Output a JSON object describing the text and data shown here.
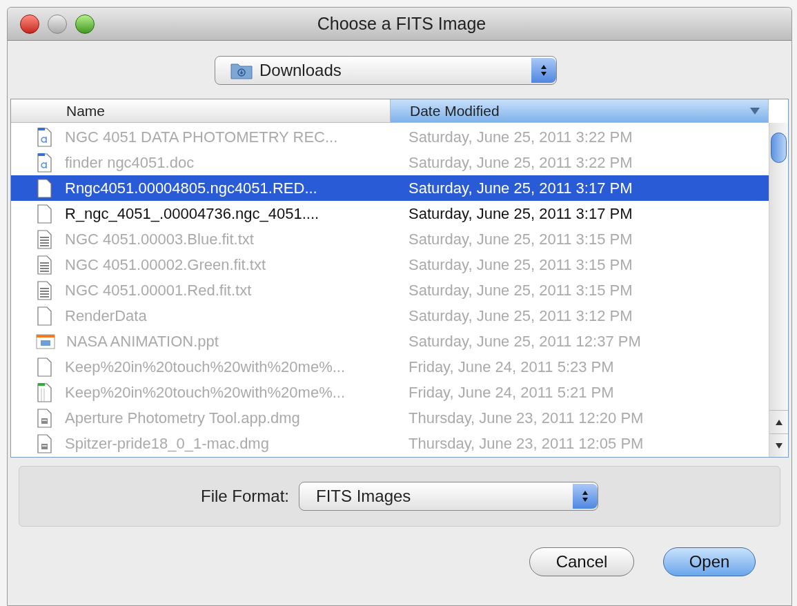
{
  "window": {
    "title": "Choose a FITS Image"
  },
  "location": {
    "value": "Downloads"
  },
  "columns": [
    {
      "label": "Name",
      "selected": false
    },
    {
      "label": "Date Modified",
      "selected": true
    }
  ],
  "files": [
    {
      "name": "NGC 4051 DATA PHOTOMETRY REC...",
      "date": "Saturday, June 25, 2011 3:22 PM",
      "kind": "doc",
      "disabled": true,
      "selected": false
    },
    {
      "name": "finder ngc4051.doc",
      "date": "Saturday, June 25, 2011 3:22 PM",
      "kind": "doc",
      "disabled": true,
      "selected": false
    },
    {
      "name": "Rngc4051.00004805.ngc4051.RED...",
      "date": "Saturday, June 25, 2011 3:17 PM",
      "kind": "blank",
      "disabled": false,
      "selected": true
    },
    {
      "name": "R_ngc_4051_.00004736.ngc_4051....",
      "date": "Saturday, June 25, 2011 3:17 PM",
      "kind": "blank",
      "disabled": false,
      "selected": false
    },
    {
      "name": "NGC 4051.00003.Blue.fit.txt",
      "date": "Saturday, June 25, 2011 3:15 PM",
      "kind": "text",
      "disabled": true,
      "selected": false
    },
    {
      "name": "NGC 4051.00002.Green.fit.txt",
      "date": "Saturday, June 25, 2011 3:15 PM",
      "kind": "text",
      "disabled": true,
      "selected": false
    },
    {
      "name": "NGC 4051.00001.Red.fit.txt",
      "date": "Saturday, June 25, 2011 3:15 PM",
      "kind": "text",
      "disabled": true,
      "selected": false
    },
    {
      "name": "RenderData",
      "date": "Saturday, June 25, 2011 3:12 PM",
      "kind": "blank",
      "disabled": true,
      "selected": false
    },
    {
      "name": "NASA ANIMATION.ppt",
      "date": "Saturday, June 25, 2011 12:37 PM",
      "kind": "slides",
      "disabled": true,
      "selected": false
    },
    {
      "name": "Keep%20in%20touch%20with%20me%...",
      "date": "Friday, June 24, 2011 5:23 PM",
      "kind": "blank",
      "disabled": true,
      "selected": false
    },
    {
      "name": "Keep%20in%20touch%20with%20me%...",
      "date": "Friday, June 24, 2011 5:21 PM",
      "kind": "green",
      "disabled": true,
      "selected": false
    },
    {
      "name": "Aperture Photometry Tool.app.dmg",
      "date": "Thursday, June 23, 2011 12:20 PM",
      "kind": "disk",
      "disabled": true,
      "selected": false
    },
    {
      "name": "Spitzer-pride18_0_1-mac.dmg",
      "date": "Thursday, June 23, 2011 12:05 PM",
      "kind": "disk",
      "disabled": true,
      "selected": false
    }
  ],
  "format": {
    "label": "File Format:",
    "value": "FITS Images"
  },
  "buttons": [
    {
      "label": "Cancel",
      "kind": "normal"
    },
    {
      "label": "Open",
      "kind": "default"
    }
  ]
}
